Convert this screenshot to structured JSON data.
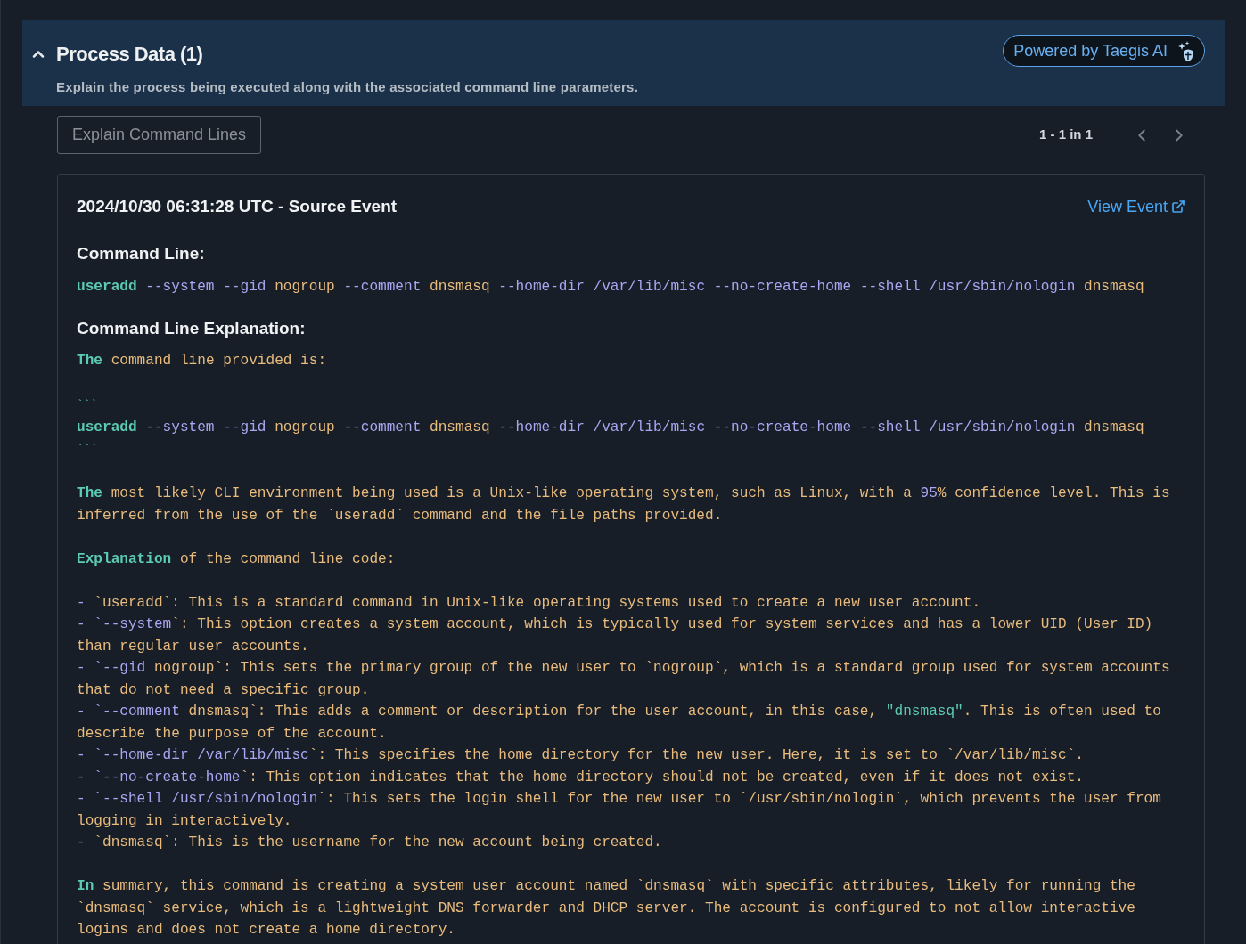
{
  "section": {
    "title": "Process Data (1)",
    "expanded": true,
    "subtitle": "Explain the process being executed along with the associated command line parameters.",
    "ai_badge": "Powered by Taegis AI"
  },
  "toolbar": {
    "explain_button": {
      "label": "Explain Command Lines",
      "disabled": true
    },
    "pagination": "1 - 1 in 1"
  },
  "event": {
    "title": "2024/10/30 06:31:28 UTC - Source Event",
    "link": "View Event",
    "command_line_heading": "Command Line:",
    "command_line": [
      {
        "kind": "keyword",
        "text": "useradd"
      },
      {
        "kind": "option",
        "text": " --system --gid"
      },
      {
        "kind": "value",
        "text": " nogroup"
      },
      {
        "kind": "option",
        "text": " --comment"
      },
      {
        "kind": "value",
        "text": " dnsmasq"
      },
      {
        "kind": "option",
        "text": " --home-dir /var/lib/misc --no-create-home --shell /usr/sbin/nologin"
      },
      {
        "kind": "value",
        "text": " dnsmasq"
      }
    ],
    "explanation_heading": "Command Line Explanation:",
    "explanation": [
      [
        [
          {
            "kind": "keyword",
            "text": "The"
          },
          {
            "kind": "value",
            "text": " command line provided is:"
          }
        ]
      ],
      [
        [
          {
            "kind": "fence",
            "text": "```"
          }
        ],
        [
          {
            "kind": "keyword",
            "text": "useradd"
          },
          {
            "kind": "option",
            "text": " --system --gid"
          },
          {
            "kind": "value",
            "text": " nogroup"
          },
          {
            "kind": "option",
            "text": " --comment"
          },
          {
            "kind": "value",
            "text": " dnsmasq"
          },
          {
            "kind": "option",
            "text": " --home-dir /var/lib/misc --no-create-home --shell /usr/sbin/nologin"
          },
          {
            "kind": "value",
            "text": " dnsmasq"
          }
        ],
        [
          {
            "kind": "fence",
            "text": "```"
          }
        ]
      ],
      [
        [
          {
            "kind": "keyword",
            "text": "The"
          },
          {
            "kind": "value",
            "text": " most likely CLI environment being used is a Unix-like operating system, such as Linux, with a "
          },
          {
            "kind": "option",
            "text": "95"
          },
          {
            "kind": "value",
            "text": "% confidence level. This is"
          }
        ],
        [
          {
            "kind": "value",
            "text": "inferred from the use of the `useradd` command and the file paths provided."
          }
        ]
      ],
      [
        [
          {
            "kind": "keyword",
            "text": "Explanation"
          },
          {
            "kind": "value",
            "text": " of the command line code:"
          }
        ]
      ],
      [
        [
          {
            "kind": "option",
            "text": "- "
          },
          {
            "kind": "value",
            "text": "`useradd`: This is a standard command in Unix-like operating systems used to create a new user account."
          }
        ],
        [
          {
            "kind": "option",
            "text": "- `--system"
          },
          {
            "kind": "value",
            "text": "`: This option creates a system account, which is typically used for system services and has a lower UID (User ID)"
          }
        ],
        [
          {
            "kind": "value",
            "text": "than regular user accounts."
          }
        ],
        [
          {
            "kind": "option",
            "text": "- `--gid"
          },
          {
            "kind": "value",
            "text": " nogroup`: This sets the primary group of the new user to `nogroup`, which is a standard group used for system accounts"
          }
        ],
        [
          {
            "kind": "value",
            "text": "that do not need a specific group."
          }
        ],
        [
          {
            "kind": "option",
            "text": "- `--comment"
          },
          {
            "kind": "value",
            "text": " dnsmasq`: This adds a comment or description for the user account, in this case, "
          },
          {
            "kind": "string",
            "text": "\"dnsmasq\""
          },
          {
            "kind": "value",
            "text": ". This is often used to"
          }
        ],
        [
          {
            "kind": "value",
            "text": "describe the purpose of the account."
          }
        ],
        [
          {
            "kind": "option",
            "text": "- `--home-dir /var/lib/misc"
          },
          {
            "kind": "value",
            "text": "`: This specifies the home directory for the new user. Here, it is set to `/var/lib/misc`."
          }
        ],
        [
          {
            "kind": "option",
            "text": "- `--no-create-home"
          },
          {
            "kind": "value",
            "text": "`: This option indicates that the home directory should not be created, even if it does not exist."
          }
        ],
        [
          {
            "kind": "option",
            "text": "- `--shell /usr/sbin/nologin"
          },
          {
            "kind": "value",
            "text": "`: This sets the login shell for the new user to `/usr/sbin/nologin`, which prevents the user from"
          }
        ],
        [
          {
            "kind": "value",
            "text": "logging in interactively."
          }
        ],
        [
          {
            "kind": "option",
            "text": "- "
          },
          {
            "kind": "value",
            "text": "`dnsmasq`: This is the username for the new account being created."
          }
        ]
      ],
      [
        [
          {
            "kind": "keyword",
            "text": "In"
          },
          {
            "kind": "value",
            "text": " summary, this command is creating a system user account named `dnsmasq` with specific attributes, likely for running the"
          }
        ],
        [
          {
            "kind": "value",
            "text": "`dnsmasq` service, which is a lightweight DNS forwarder and DHCP server. The account is configured to not allow interactive"
          }
        ],
        [
          {
            "kind": "value",
            "text": "logins and does not create a home directory."
          }
        ]
      ]
    ]
  }
}
